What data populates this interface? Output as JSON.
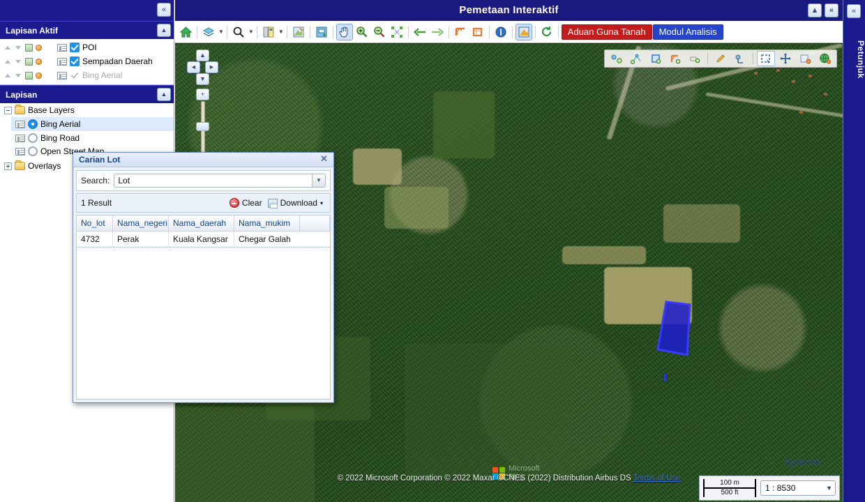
{
  "app": {
    "map_title": "Pemetaan Interaktif",
    "collapse_icon": "«",
    "panel_toggle_icon": "▲"
  },
  "left_panel": {
    "active_layers": {
      "header": "Lapisan Aktif",
      "items": [
        {
          "label": "POI",
          "checked": true,
          "enabled": true
        },
        {
          "label": "Sempadan Daerah",
          "checked": true,
          "enabled": true
        },
        {
          "label": "Bing Aerial",
          "checked": true,
          "enabled": false
        }
      ]
    },
    "layers": {
      "header": "Lapisan",
      "tree": [
        {
          "label": "Base Layers",
          "type": "folder",
          "expanded": true
        },
        {
          "label": "Bing Aerial",
          "type": "radio",
          "selected": true
        },
        {
          "label": "Bing Road",
          "type": "radio",
          "selected": false
        },
        {
          "label": "Open Street Map",
          "type": "radio",
          "selected": false
        },
        {
          "label": "Overlays",
          "type": "folder",
          "expanded": false
        }
      ]
    }
  },
  "toolbar": {
    "buttons": [
      {
        "name": "home-icon",
        "glyph": "home"
      },
      {
        "name": "layers-icon",
        "glyph": "layers",
        "caret": true
      },
      {
        "name": "search-icon",
        "glyph": "search",
        "caret": true
      },
      {
        "name": "bookmark-icon",
        "glyph": "bookmark",
        "caret": true
      },
      {
        "name": "legend-icon",
        "glyph": "legend"
      },
      {
        "name": "print-icon",
        "glyph": "print"
      },
      {
        "name": "pan-hand-icon",
        "glyph": "hand",
        "active": true
      },
      {
        "name": "zoom-in-icon",
        "glyph": "zoomin"
      },
      {
        "name": "zoom-out-icon",
        "glyph": "zoomout"
      },
      {
        "name": "zoom-extent-icon",
        "glyph": "extent"
      },
      {
        "name": "nav-back-icon",
        "glyph": "arrow-left"
      },
      {
        "name": "nav-forward-icon",
        "glyph": "arrow-right"
      },
      {
        "name": "measure-line-icon",
        "glyph": "measure-line"
      },
      {
        "name": "measure-area-icon",
        "glyph": "measure-area"
      },
      {
        "name": "info-icon",
        "glyph": "info"
      },
      {
        "name": "select-icon",
        "glyph": "select"
      },
      {
        "name": "refresh-icon",
        "glyph": "refresh"
      }
    ],
    "aduan_label": "Aduan Guna Tanah",
    "modul_label": "Modul Analisis",
    "aduan_color": "#c21c1c",
    "modul_color": "#2544c9"
  },
  "draw_toolbar": {
    "buttons": [
      {
        "name": "draw-point-icon"
      },
      {
        "name": "draw-line-icon"
      },
      {
        "name": "draw-polygon-icon"
      },
      {
        "name": "draw-rectangle-icon"
      },
      {
        "name": "draw-freehand-icon"
      },
      {
        "name": "edit-pencil-icon"
      },
      {
        "name": "erase-icon"
      },
      {
        "name": "selection-box-icon",
        "active": true
      },
      {
        "name": "move-icon"
      },
      {
        "name": "delete-feature-icon"
      },
      {
        "name": "globe-icon"
      }
    ]
  },
  "nav_control": {
    "up": "▲",
    "down": "▼",
    "left": "◄",
    "right": "►",
    "zoom_in": "+",
    "zoom_out": "−"
  },
  "dialog": {
    "title": "Carian Lot",
    "close_icon": "✕",
    "search_label": "Search:",
    "search_value": "Lot",
    "search_placeholder": "Lot",
    "result_count": "1 Result",
    "clear_label": "Clear",
    "download_label": "Download",
    "download_caret": "▾",
    "columns": [
      "No_lot",
      "Nama_negeri",
      "Nama_daerah",
      "Nama_mukim"
    ],
    "rows": [
      [
        "4732",
        "Perak",
        "Kuala Kangsar",
        "Chegar Galah"
      ]
    ]
  },
  "map": {
    "attribution": "© 2022 Microsoft Corporation © 2022 Maxar ©CNES (2022) Distribution Airbus DS",
    "terms_label": "Terms of Use",
    "bing_brand_line1": "Microsoft",
    "bing_brand_line2": "Bing",
    "watermark": "hydrodx",
    "scale_metric": "100 m",
    "scale_imperial": "500 ft",
    "scale_value": "1 : 8530",
    "scale_caret": "▼",
    "parcel_fill": "#1c1ccc",
    "parcel_stroke": "#2b2bf0"
  },
  "right_panel": {
    "label": "Petunjuk",
    "collapse_icon": "«"
  }
}
